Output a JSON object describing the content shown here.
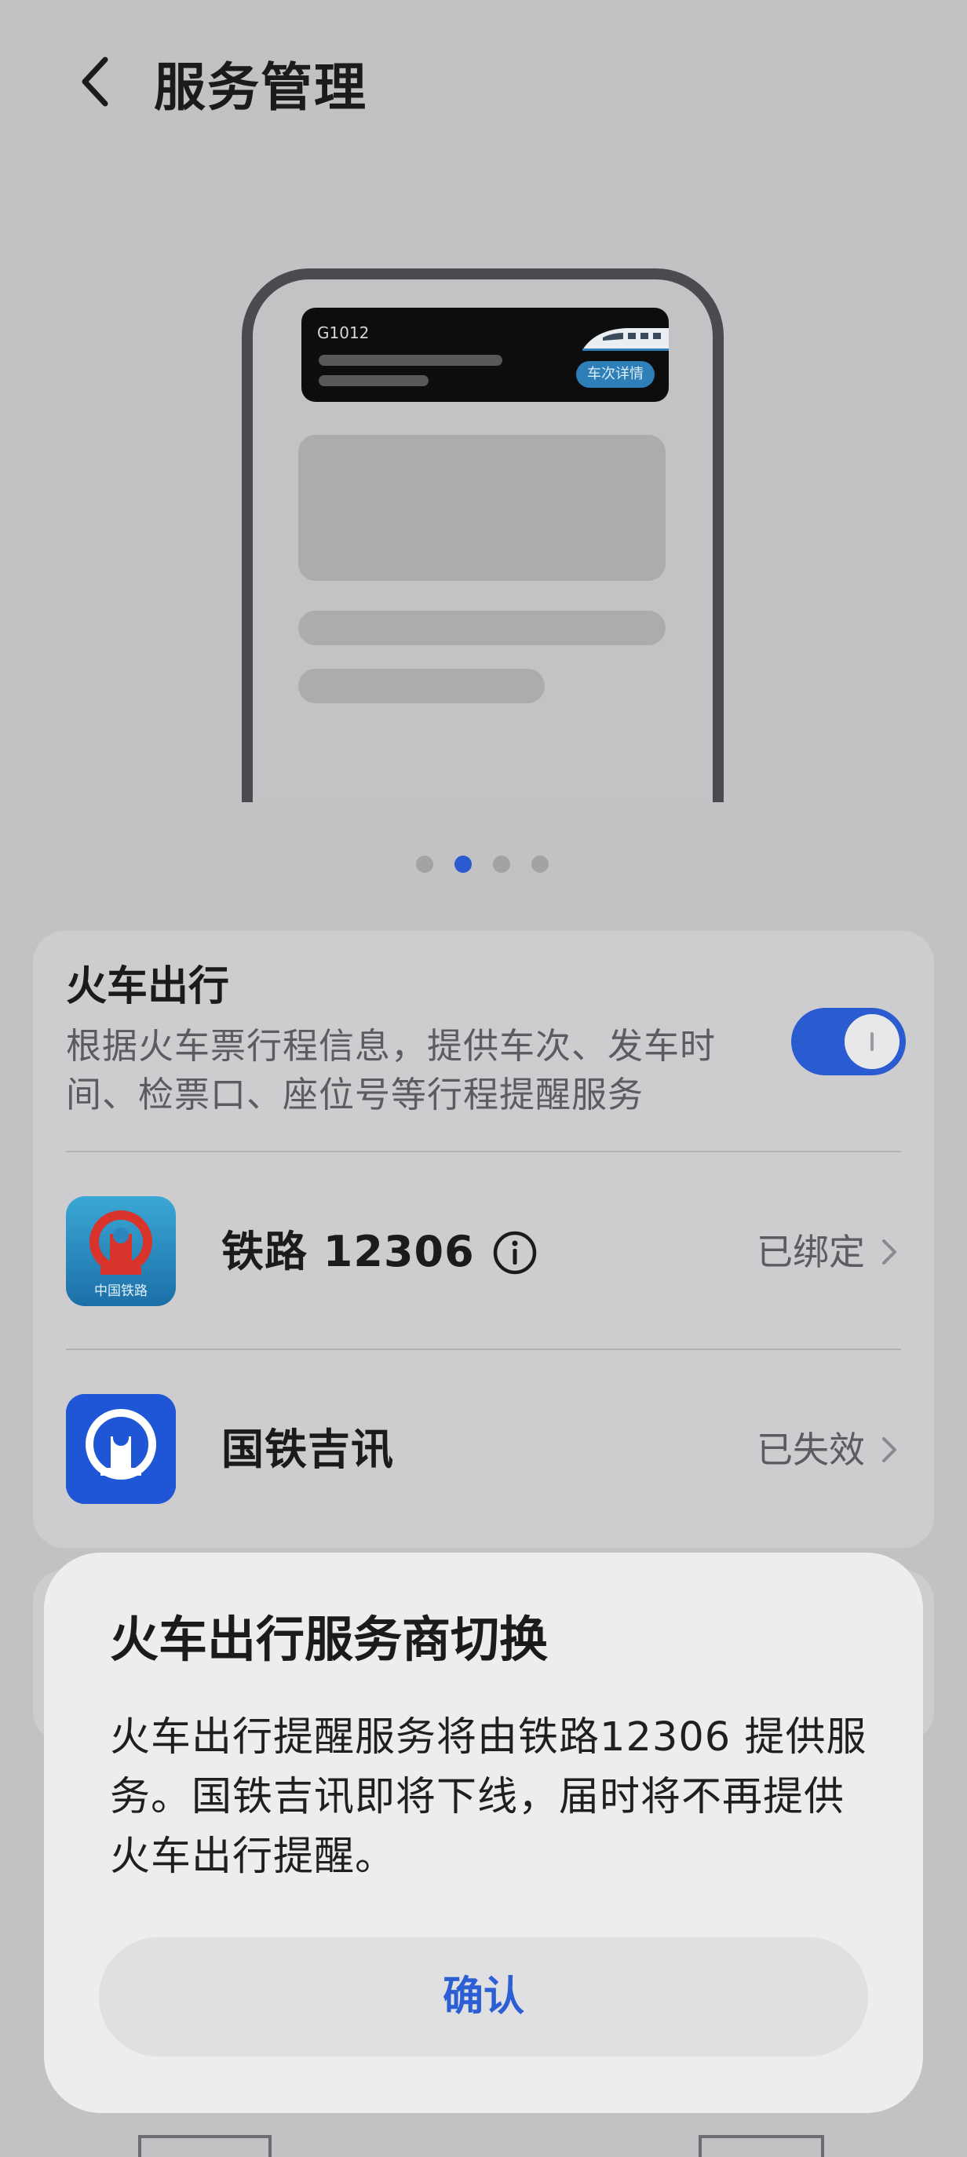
{
  "header": {
    "title": "服务管理"
  },
  "illustration": {
    "train_code": "G1012",
    "button_label": "车次详情",
    "pager": {
      "count": 4,
      "active_index": 1
    }
  },
  "service": {
    "title": "火车出行",
    "description": "根据火车票行程信息，提供车次、发车时间、检票口、座位号等行程提醒服务",
    "enabled": true
  },
  "providers": [
    {
      "name": "铁路 12306",
      "icon_caption": "中国铁路",
      "status": "已绑定",
      "icon": "china-railway-icon"
    },
    {
      "name": "国铁吉讯",
      "status": "已失效",
      "icon": "railway-logo-icon"
    }
  ],
  "dialog": {
    "title": "火车出行服务商切换",
    "body": "火车出行提醒服务将由铁路12306 提供服务。国铁吉讯即将下线，届时将不再提供火车出行提醒。",
    "confirm_label": "确认"
  },
  "colors": {
    "accent": "#2b5bd0",
    "background": "#c2c2c4",
    "dialog": "#ededef"
  }
}
